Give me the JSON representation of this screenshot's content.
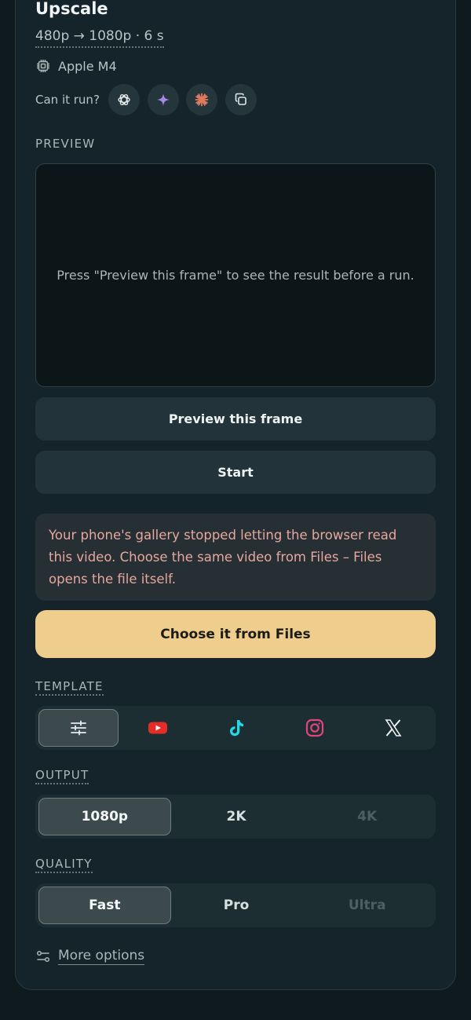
{
  "header": {
    "title": "Upscale",
    "subtitle": "480p → 1080p · 6 s",
    "device": "Apple M4",
    "can_run_label": "Can it run?",
    "can_run_icons": [
      "chatgpt-icon",
      "gemini-sparkle-icon",
      "claude-icon",
      "copy-icon"
    ]
  },
  "preview": {
    "label": "PREVIEW",
    "placeholder": "Press \"Preview this frame\" to see the result before a run.",
    "button_label": "Preview this frame"
  },
  "start_button_label": "Start",
  "notice": {
    "text": "Your phone's gallery stopped letting the browser read this video. Choose the same video from Files – Files opens the file itself.",
    "action_label": "Choose it from Files"
  },
  "template": {
    "label": "TEMPLATE",
    "options": [
      "custom-sliders-icon",
      "youtube-icon",
      "tiktok-icon",
      "instagram-icon",
      "x-icon"
    ],
    "selected": "custom-sliders-icon"
  },
  "output": {
    "label": "OUTPUT",
    "options": [
      "1080p",
      "2K",
      "4K"
    ],
    "selected": "1080p",
    "disabled": [
      "4K"
    ]
  },
  "quality": {
    "label": "QUALITY",
    "options": [
      "Fast",
      "Pro",
      "Ultra"
    ],
    "selected": "Fast",
    "disabled": [
      "Ultra"
    ]
  },
  "more_options_label": "More options",
  "colors": {
    "page_bg": "#0f1a1e",
    "panel_bg": "#15242a",
    "accent_button": "#efcd8d",
    "notice_text": "#e8a79e",
    "youtube": "#e52d27",
    "tiktok": "#25d8e6",
    "instagram": "#e0457b",
    "claude": "#e07a5f",
    "gemini": "#a48ae6"
  }
}
